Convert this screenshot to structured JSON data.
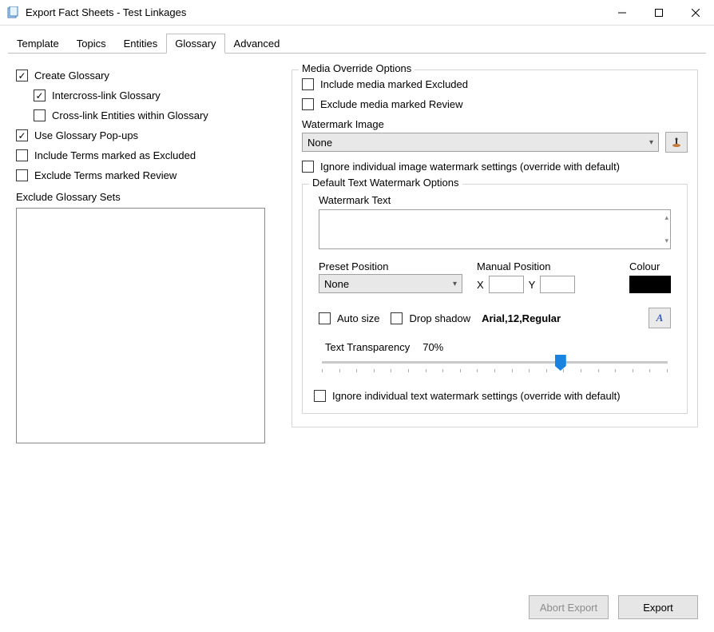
{
  "window": {
    "title": "Export Fact Sheets - Test Linkages"
  },
  "tabs": [
    "Template",
    "Topics",
    "Entities",
    "Glossary",
    "Advanced"
  ],
  "active_tab": "Glossary",
  "left": {
    "create_glossary": "Create Glossary",
    "intercross": "Intercross-link Glossary",
    "crosslink_entities": "Cross-link Entities within Glossary",
    "use_popup": "Use Glossary Pop-ups",
    "include_excluded": "Include Terms marked as Excluded",
    "exclude_review": "Exclude Terms marked Review",
    "exclude_sets_label": "Exclude Glossary Sets"
  },
  "media": {
    "legend": "Media Override Options",
    "include_excluded": "Include media marked Excluded",
    "exclude_review": "Exclude media marked Review",
    "watermark_image_label": "Watermark Image",
    "watermark_image_value": "None",
    "ignore_img_wm": "Ignore individual image watermark settings (override with default)"
  },
  "textwm": {
    "legend": "Default Text Watermark Options",
    "watermark_text_label": "Watermark Text",
    "preset_label": "Preset Position",
    "preset_value": "None",
    "manual_label": "Manual Position",
    "x_label": "X",
    "y_label": "Y",
    "colour_label": "Colour",
    "auto_size": "Auto size",
    "drop_shadow": "Drop shadow",
    "font_desc": "Arial,12,Regular",
    "trans_label": "Text Transparency",
    "trans_value": "70%",
    "ignore_text_wm": "Ignore individual text watermark settings (override with default)"
  },
  "buttons": {
    "abort": "Abort Export",
    "export": "Export"
  }
}
